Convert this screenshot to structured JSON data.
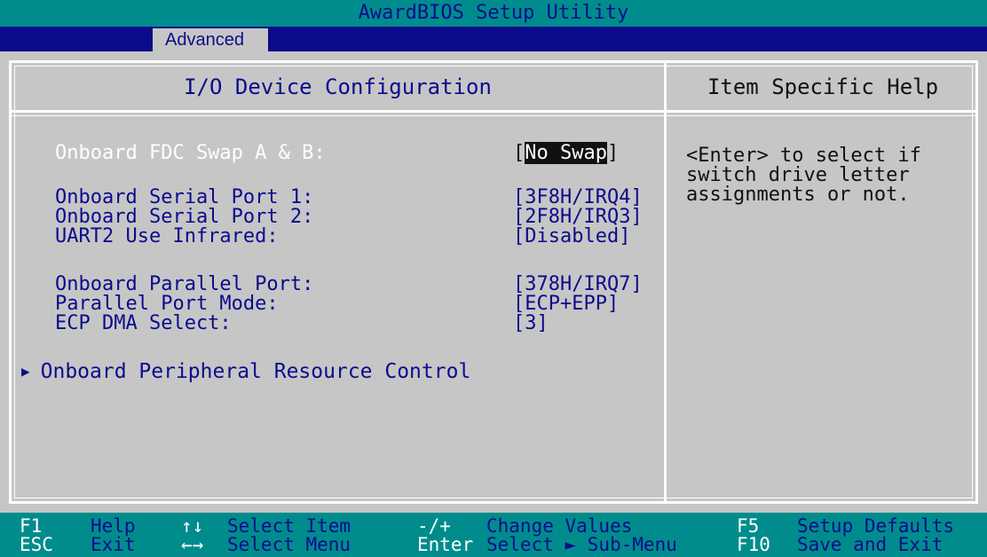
{
  "title": "AwardBIOS Setup Utility",
  "menu": {
    "active_tab": "Advanced"
  },
  "panel": {
    "title": "I/O Device Configuration",
    "help_title": "Item Specific Help"
  },
  "items": [
    {
      "label": "Onboard FDC Swap A & B:",
      "value": "No Swap"
    },
    {
      "label": "Onboard Serial Port 1:",
      "value": "[3F8H/IRQ4]"
    },
    {
      "label": "Onboard Serial Port 2:",
      "value": "[2F8H/IRQ3]"
    },
    {
      "label": "UART2 Use Infrared:",
      "value": "[Disabled]"
    },
    {
      "label": "Onboard Parallel Port:",
      "value": "[378H/IRQ7]"
    },
    {
      "label": "Parallel Port Mode:",
      "value": "[ECP+EPP]"
    },
    {
      "label": "ECP DMA Select:",
      "value": "[3]"
    }
  ],
  "submenu": {
    "label": "Onboard Peripheral Resource Control",
    "icon": "right-triangle-icon"
  },
  "help": {
    "text": "<Enter> to select if\nswitch drive letter\nassignments or not."
  },
  "footer": {
    "keys": [
      {
        "key": "F1",
        "label": "Help"
      },
      {
        "key": "ESC",
        "label": "Exit"
      },
      {
        "key": "↑↓",
        "label": "Select Item"
      },
      {
        "key": "←→",
        "label": "Select Menu"
      },
      {
        "key": "-/+",
        "label": "Change Values"
      },
      {
        "key": "Enter",
        "label": "Select ► Sub-Menu"
      },
      {
        "key": "F5",
        "label": "Setup Defaults"
      },
      {
        "key": "F10",
        "label": "Save and Exit"
      }
    ]
  },
  "colors": {
    "background": "#c6c6c6",
    "accent": "#008c8c",
    "menu": "#0b0b8c",
    "text": "#0b0b8c"
  }
}
